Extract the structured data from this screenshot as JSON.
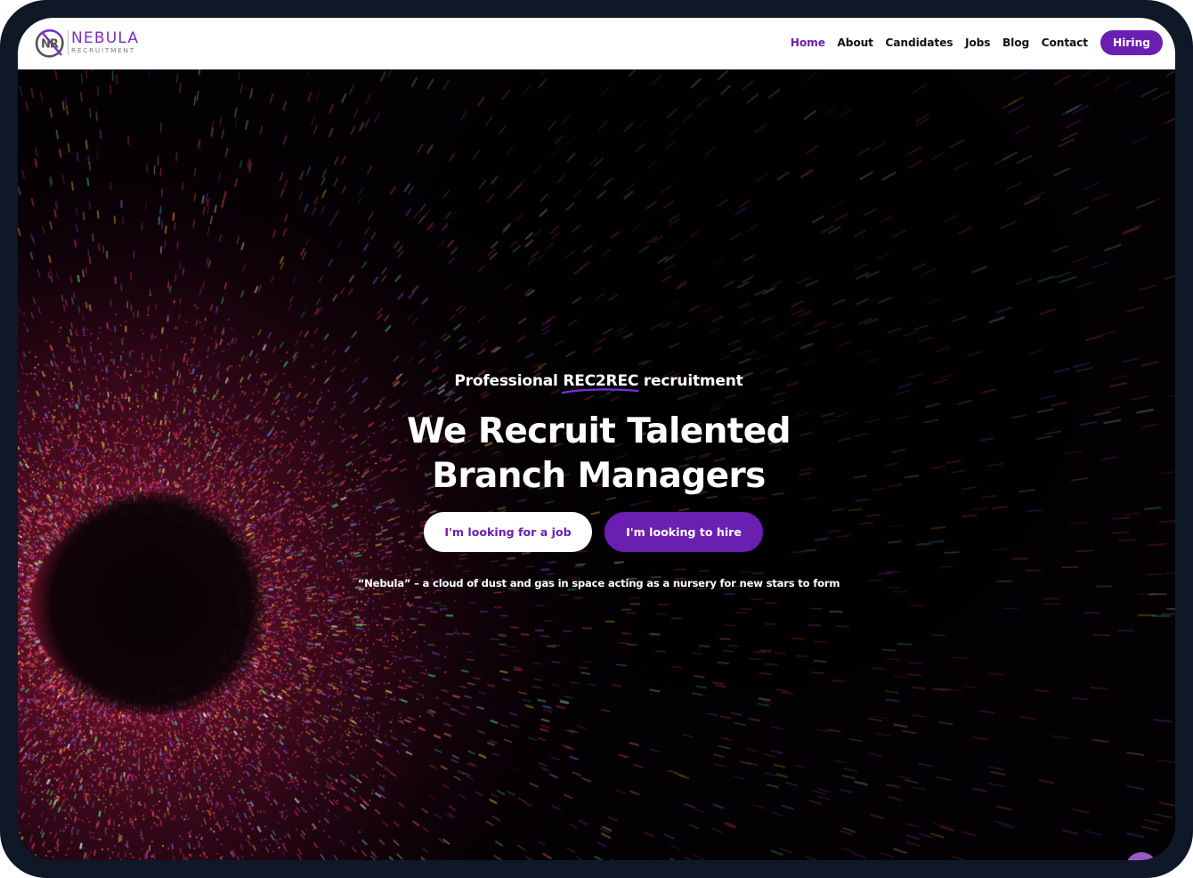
{
  "brand": {
    "name": "NEBULA",
    "subtitle": "RECRUITMENT",
    "monogram": "NR",
    "accent_color": "#6b1fb1",
    "frame_color": "#0f1826"
  },
  "nav": {
    "items": [
      {
        "label": "Home",
        "active": true
      },
      {
        "label": "About",
        "active": false
      },
      {
        "label": "Candidates",
        "active": false
      },
      {
        "label": "Jobs",
        "active": false
      },
      {
        "label": "Blog",
        "active": false
      },
      {
        "label": "Contact",
        "active": false
      }
    ],
    "cta_label": "Hiring"
  },
  "hero": {
    "tagline_prefix": "Professional",
    "tagline_highlight": "REC2REC",
    "tagline_suffix": "recruitment",
    "headline_line1": "We Recruit Talented",
    "headline_line2": "Branch Managers",
    "primary_button": "I'm looking for a job",
    "secondary_button": "I'm looking to hire",
    "definition": "“Nebula” – a cloud of dust and gas in space acting as a nursery for new stars to form",
    "background": "nebula-starfield-image"
  },
  "widgets": {
    "chat_icon": "chat-bubble-icon"
  }
}
